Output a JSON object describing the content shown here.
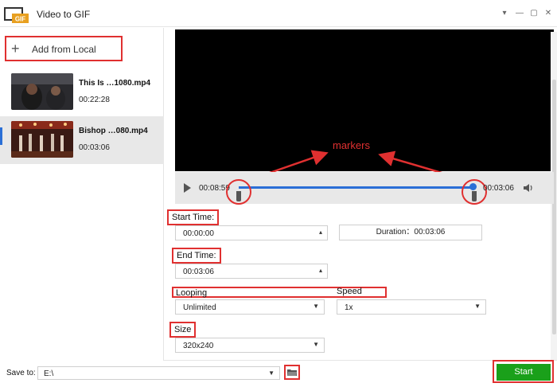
{
  "app": {
    "title": "Video to GIF",
    "logo_text": "GIF"
  },
  "window_controls": {
    "menu": "▾",
    "minimize": "—",
    "maximize": "▢",
    "close": "✕"
  },
  "sidebar": {
    "add_label": "Add from Local",
    "files": [
      {
        "name": "This Is …1080.mp4",
        "duration": "00:22:28"
      },
      {
        "name": "Bishop …080.mp4",
        "duration": "00:03:06"
      }
    ]
  },
  "annotation": {
    "markers": "markers"
  },
  "player": {
    "time_start": "00:08:59",
    "time_end": "00:03:06"
  },
  "form": {
    "start_time_label": "Start Time:",
    "start_time_value": "00:00:00",
    "duration_text": "Duration：00:03:06",
    "end_time_label": "End Time:",
    "end_time_value": "00:03:06",
    "looping_label": "Looping",
    "looping_value": "Unlimited",
    "speed_label": "Speed",
    "speed_value": "1x",
    "size_label": "Size",
    "size_value": "320x240"
  },
  "bottom": {
    "save_to_label": "Save to:",
    "save_path": "E:\\",
    "start_label": "Start"
  },
  "colors": {
    "accent": "#2b6fd6",
    "highlight": "#e03030",
    "start": "#1aa01a"
  }
}
